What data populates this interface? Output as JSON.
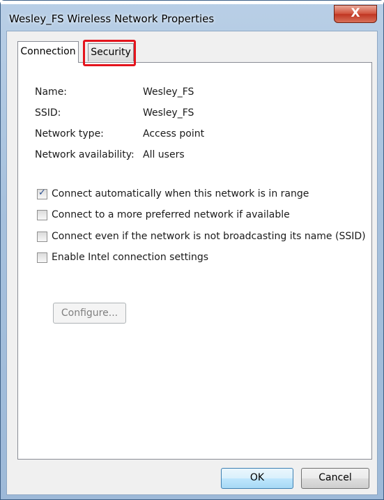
{
  "window": {
    "title": "Wesley_FS Wireless Network Properties",
    "close_label": "X"
  },
  "tabs": [
    {
      "label": "Connection",
      "selected": true
    },
    {
      "label": "Security",
      "selected": false,
      "highlighted": true
    }
  ],
  "properties": [
    {
      "label": "Name:",
      "value": "Wesley_FS"
    },
    {
      "label": "SSID:",
      "value": "Wesley_FS"
    },
    {
      "label": "Network type:",
      "value": "Access point"
    },
    {
      "label": "Network availability:",
      "value": "All users"
    }
  ],
  "options": [
    {
      "label": "Connect automatically when this network is in range",
      "checked": true
    },
    {
      "label": "Connect to a more preferred network if available",
      "checked": false
    },
    {
      "label": "Connect even if the network is not broadcasting its name (SSID)",
      "checked": false
    },
    {
      "label": "Enable Intel connection settings",
      "checked": false
    }
  ],
  "configure_label": "Configure...",
  "buttons": {
    "ok": "OK",
    "cancel": "Cancel"
  },
  "colors": {
    "highlight": "#e4141c",
    "titlebar": "#a7c1dd",
    "close": "#c8412b"
  }
}
